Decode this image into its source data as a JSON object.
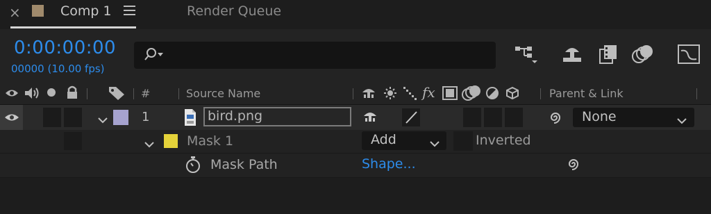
{
  "tabs": {
    "close_glyph": "×",
    "comp_label": "Comp 1",
    "comp_swatch_color": "#a08a6c",
    "render_queue_label": "Render Queue"
  },
  "toolbar": {
    "timecode": "0:00:00:00",
    "frame_info": "00000 (10.00 fps)",
    "search_placeholder": "",
    "accent_color": "#2d8ceb"
  },
  "columns": {
    "number": "#",
    "source_name": "Source Name",
    "parent_link": "Parent & Link"
  },
  "layer": {
    "index": "1",
    "name": "bird.png",
    "label_color": "#a6a3cf",
    "parent": "None"
  },
  "mask": {
    "name": "Mask 1",
    "label_color": "#e4d23a",
    "mode": "Add",
    "inverted_label": "Inverted",
    "path_label": "Mask Path",
    "path_value": "Shape..."
  }
}
